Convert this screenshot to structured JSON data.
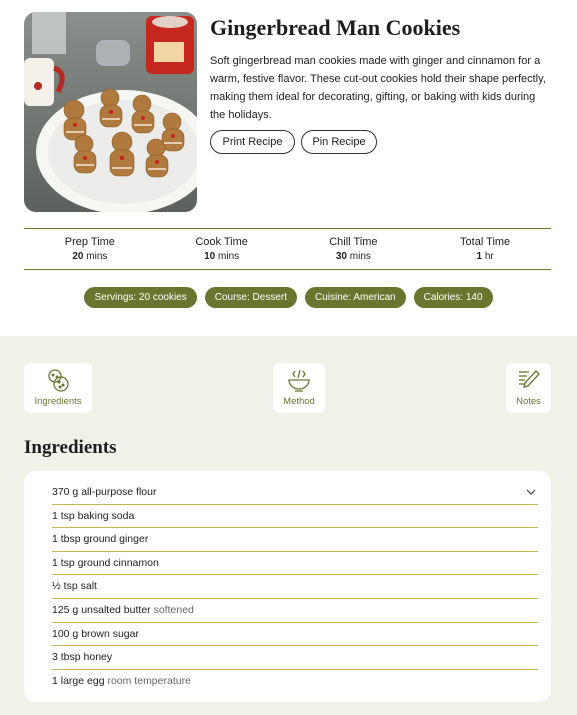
{
  "recipe": {
    "title": "Gingerbread Man Cookies",
    "description": "Soft gingerbread man cookies made with ginger and cinnamon for a warm, festive flavor. These cut-out cookies hold their shape perfectly, making them ideal for decorating, gifting, or baking with kids during the holidays.",
    "print_label": "Print Recipe",
    "pin_label": "Pin Recipe"
  },
  "times": [
    {
      "label": "Prep Time",
      "value": "20",
      "unit": "mins"
    },
    {
      "label": "Cook Time",
      "value": "10",
      "unit": "mins"
    },
    {
      "label": "Chill Time",
      "value": "30",
      "unit": "mins"
    },
    {
      "label": "Total Time",
      "value": "1",
      "unit": "hr"
    }
  ],
  "pills": [
    "Servings: 20 cookies",
    "Course: Dessert",
    "Cuisine: American",
    "Calories: 140"
  ],
  "tabs": {
    "ingredients": {
      "label": "Ingredients",
      "icon": "cookies-icon"
    },
    "method": {
      "label": "Method",
      "icon": "mixing-bowl-icon"
    },
    "notes": {
      "label": "Notes",
      "icon": "notes-pencil-icon"
    }
  },
  "ingredients_heading": "Ingredients",
  "ingredients": [
    {
      "text": "370 g all-purpose flour",
      "note": ""
    },
    {
      "text": "1 tsp baking soda",
      "note": ""
    },
    {
      "text": "1 tbsp ground ginger",
      "note": ""
    },
    {
      "text": "1 tsp ground cinnamon",
      "note": ""
    },
    {
      "text": "½ tsp salt",
      "note": ""
    },
    {
      "text": "125 g unsalted butter",
      "note": "softened"
    },
    {
      "text": "100 g brown sugar",
      "note": ""
    },
    {
      "text": "3 tbsp honey",
      "note": ""
    },
    {
      "text": "1 large egg",
      "note": "room temperature"
    }
  ],
  "colors": {
    "accent": "#6b7530",
    "divider": "#c9b653",
    "section_bg": "#f1f1ea"
  }
}
